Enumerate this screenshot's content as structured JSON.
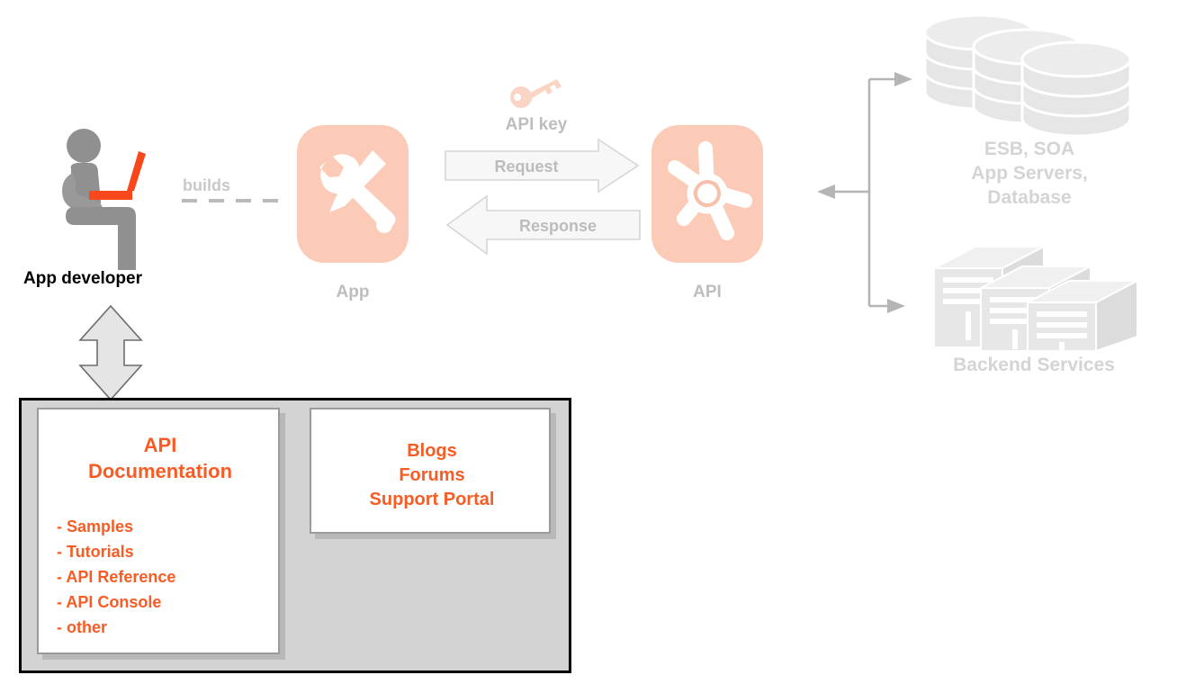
{
  "diagram": {
    "title": "API platform architecture diagram",
    "colors": {
      "tile_fill": "#fccbb8",
      "accent_orange": "#f75c24",
      "grey_label": "#bdbdbd",
      "grey_icon": "#909090",
      "panel_grey": "#d3d3d3",
      "connector_grey": "#b5b5b5"
    }
  },
  "actors": {
    "developer": {
      "label": "App developer",
      "icon": "seated-developer-with-laptop-icon"
    }
  },
  "links": {
    "builds": {
      "label": "builds",
      "style": "dashed"
    },
    "docs_link": {
      "icon": "double-headed-vertical-arrow-icon"
    },
    "backend_connector": {
      "icon": "branching-connector-icon"
    }
  },
  "nodes": {
    "app": {
      "label": "App",
      "icon": "wrench-and-pencil-icon"
    },
    "api": {
      "label": "API",
      "icon": "api-starburst-icon"
    }
  },
  "api_key": {
    "label": "API key",
    "icon": "key-icon"
  },
  "flows": [
    {
      "label": "Request",
      "direction": "right",
      "icon": "block-arrow-right-icon"
    },
    {
      "label": "Response",
      "direction": "left",
      "icon": "block-arrow-left-icon"
    }
  ],
  "backend": {
    "datastore": {
      "icon": "database-cylinders-icon",
      "lines": [
        "ESB, SOA",
        "App Servers,",
        "Database"
      ]
    },
    "services": {
      "icon": "server-racks-icon",
      "label": "Backend Services"
    }
  },
  "developer_portal": {
    "documentation": {
      "title_lines": [
        "API",
        "Documentation"
      ],
      "items": [
        "- Samples",
        "- Tutorials",
        "- API Reference",
        "- API Console",
        "- other"
      ]
    },
    "community": {
      "lines": [
        "Blogs",
        "Forums",
        "Support Portal"
      ]
    }
  }
}
